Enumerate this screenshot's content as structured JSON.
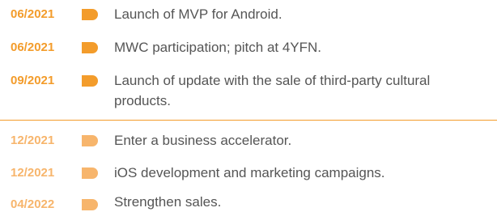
{
  "colors": {
    "accent": "#f39c2b",
    "text": "#555555",
    "divider": "#f39c2b"
  },
  "milestones": [
    {
      "date": "06/2021",
      "text_lines": [
        "Launch of MVP for Android."
      ]
    },
    {
      "date": "06/2021",
      "text_lines": [
        "MWC participation; pitch at 4YFN."
      ]
    },
    {
      "date": "09/2021",
      "text_lines": [
        "Launch of update with the sale of third-party cultural",
        "products."
      ]
    },
    {
      "date": "12/2021",
      "text_lines": [
        "Enter a business accelerator."
      ]
    },
    {
      "date": "12/2021",
      "text_lines": [
        "iOS development and marketing campaigns."
      ]
    },
    {
      "date": "04/2022",
      "text_lines": [
        "Strengthen sales."
      ]
    }
  ]
}
